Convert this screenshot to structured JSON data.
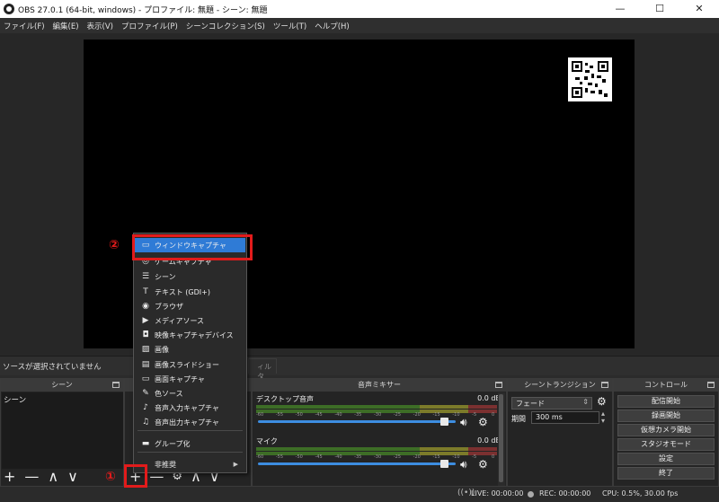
{
  "window": {
    "title": "OBS 27.0.1 (64-bit, windows) - プロファイル: 無題 - シーン: 無題",
    "minimize": "—",
    "maximize": "☐",
    "close": "✕"
  },
  "menubar": [
    "ファイル(F)",
    "編集(E)",
    "表示(V)",
    "プロファイル(P)",
    "シーンコレクション(S)",
    "ツール(T)",
    "ヘルプ(H)"
  ],
  "sources_bar": {
    "no_source_text": "ソースが選択されていません",
    "filter_tab": "ィルタ"
  },
  "scene_dock": {
    "title": "シーン",
    "items": [
      "シーン"
    ],
    "tools": [
      "+",
      "—",
      "∧",
      "∨"
    ]
  },
  "source_dock": {
    "tools": [
      "+",
      "—",
      "⚙",
      "∧",
      "∨"
    ]
  },
  "mixer_dock": {
    "title": "音声ミキサー",
    "tracks": [
      {
        "name": "デスクトップ音声",
        "db": "0.0 dB",
        "volume": 0.95
      },
      {
        "name": "マイク",
        "db": "0.0 dB",
        "volume": 0.95
      }
    ],
    "scale": [
      "-60",
      "-55",
      "-50",
      "-45",
      "-40",
      "-35",
      "-30",
      "-25",
      "-20",
      "-15",
      "-10",
      "-5",
      "0"
    ]
  },
  "transition_dock": {
    "title": "シーントランジション",
    "selected": "フェード",
    "duration_label": "期間",
    "duration_value": "300 ms"
  },
  "controls_dock": {
    "title": "コントロール",
    "buttons": [
      "配信開始",
      "録画開始",
      "仮想カメラ開始",
      "スタジオモード",
      "設定",
      "終了"
    ]
  },
  "statusbar": {
    "live": "LIVE: 00:00:00",
    "rec": "REC: 00:00:00",
    "cpu": "CPU: 0.5%, 30.00 fps"
  },
  "context_menu": {
    "items": [
      {
        "label": "ウィンドウキャプチャ",
        "icon": "window-icon",
        "glyph": "▭"
      },
      {
        "label": "ゲームキャプチャ",
        "icon": "gamepad-icon",
        "glyph": "◎"
      },
      {
        "label": "シーン",
        "icon": "list-icon",
        "glyph": "☰"
      },
      {
        "label": "テキスト (GDI+)",
        "icon": "text-icon",
        "glyph": "T"
      },
      {
        "label": "ブラウザ",
        "icon": "globe-icon",
        "glyph": "◉"
      },
      {
        "label": "メディアソース",
        "icon": "play-icon",
        "glyph": "▶"
      },
      {
        "label": "映像キャプチャデバイス",
        "icon": "camera-icon",
        "glyph": "◘"
      },
      {
        "label": "画像",
        "icon": "image-icon",
        "glyph": "▨"
      },
      {
        "label": "画像スライドショー",
        "icon": "slideshow-icon",
        "glyph": "▤"
      },
      {
        "label": "画面キャプチャ",
        "icon": "monitor-icon",
        "glyph": "▭"
      },
      {
        "label": "色ソース",
        "icon": "brush-icon",
        "glyph": "✎"
      },
      {
        "label": "音声入力キャプチャ",
        "icon": "microphone-icon",
        "glyph": "♪"
      },
      {
        "label": "音声出力キャプチャ",
        "icon": "speaker-icon",
        "glyph": "♫"
      },
      {
        "label": "グループ化",
        "icon": "folder-icon",
        "glyph": "▬"
      },
      {
        "label": "非推奨",
        "icon": "",
        "glyph": ""
      }
    ]
  },
  "annotations": {
    "marker1": "①",
    "marker2": "②"
  },
  "colors": {
    "highlight": "#2f7bd6",
    "annotation_red": "#e21b1b",
    "slider_blue": "#3d8de0"
  }
}
